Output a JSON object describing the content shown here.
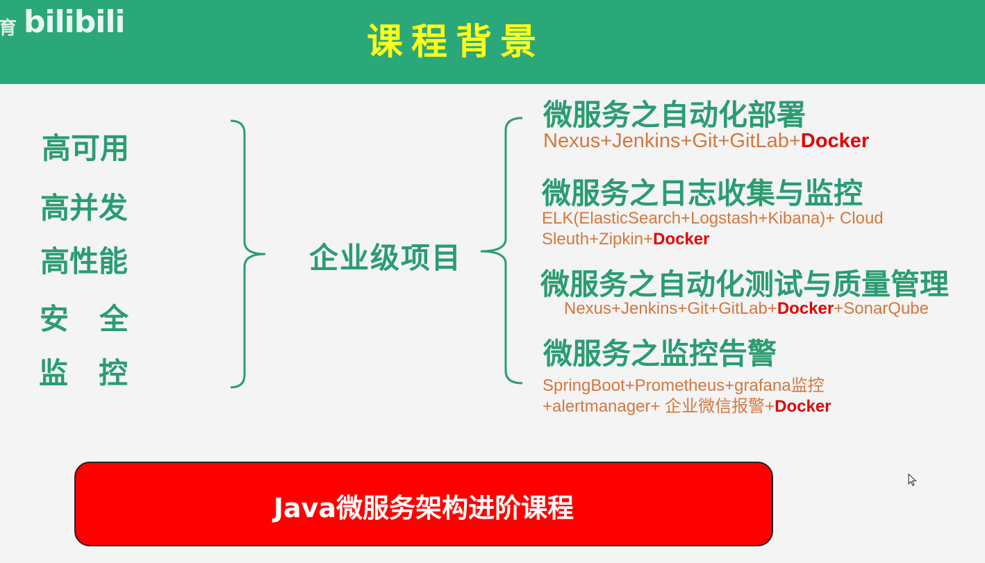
{
  "header": {
    "logo_fragment": "育",
    "logo": "bilibili",
    "title": "课程背景"
  },
  "left_items": [
    "高可用",
    "高并发",
    "高性能",
    "安全",
    "监控"
  ],
  "center_label": "企业级项目",
  "right_items": [
    {
      "heading": "微服务之自动化部署",
      "detail": "Nexus+Jenkins+Git+GitLab+",
      "highlight": "Docker"
    },
    {
      "heading": "微服务之日志收集与监控",
      "detail_line1": "ELK(ElasticSearch+Logstash+Kibana)+ Cloud",
      "detail_line2": "Sleuth+Zipkin+",
      "highlight": "Docker"
    },
    {
      "heading": "微服务之自动化测试与质量管理",
      "detail_pre": "Nexus+Jenkins+Git+GitLab+",
      "highlight": "Docker",
      "detail_post": "+SonarQube"
    },
    {
      "heading": "微服务之监控告警",
      "detail_line1": "SpringBoot+Prometheus+grafana监控",
      "detail_line2": "+alertmanager+ 企业微信报警+",
      "highlight": "Docker"
    }
  ],
  "banner": {
    "label": "Java微服务架构进阶课程"
  },
  "colors": {
    "header_bg": "#2aa879",
    "title": "#ffff1a",
    "green_text": "#2a9c72",
    "detail_text": "#d3773d",
    "highlight": "#e30000",
    "banner_bg": "#ff0000"
  },
  "icons": [
    "mouse-cursor-icon"
  ]
}
